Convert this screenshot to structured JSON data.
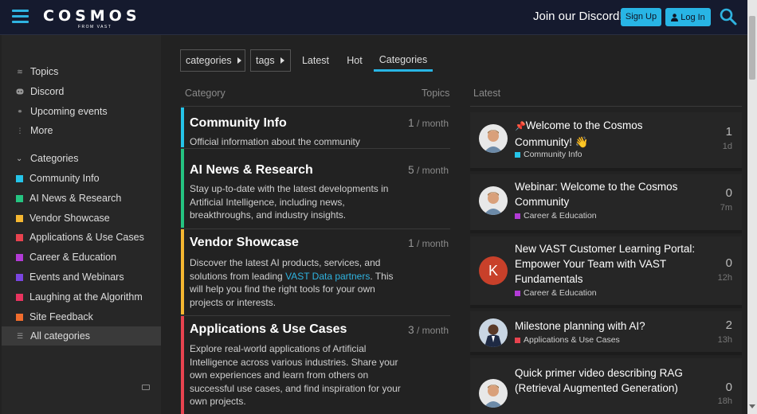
{
  "header": {
    "logo_main": "COSMOS",
    "logo_sub": "FROM VAST",
    "discord_text": "Join our Discord!",
    "signup_label": "Sign Up",
    "login_label": "Log In"
  },
  "sidebar": {
    "nav": [
      {
        "label": "Topics",
        "icon": "layers-icon"
      },
      {
        "label": "Discord",
        "icon": "discord-icon"
      },
      {
        "label": "Upcoming events",
        "icon": "link-icon"
      },
      {
        "label": "More",
        "icon": "vertical-ellipsis-icon"
      }
    ],
    "categories_header": "Categories",
    "categories": [
      {
        "label": "Community Info",
        "color": "#25c4e8"
      },
      {
        "label": "AI News & Research",
        "color": "#25c481"
      },
      {
        "label": "Vendor Showcase",
        "color": "#f5b731"
      },
      {
        "label": "Applications & Use Cases",
        "color": "#e8434f"
      },
      {
        "label": "Career & Education",
        "color": "#b23bd6"
      },
      {
        "label": "Events and Webinars",
        "color": "#7a45e0"
      },
      {
        "label": "Laughing at the Algorithm",
        "color": "#e8345f"
      },
      {
        "label": "Site Feedback",
        "color": "#f06c2d"
      }
    ],
    "all_categories": "All categories"
  },
  "nav": {
    "categories_dropdown": "categories",
    "tags_dropdown": "tags",
    "tabs": [
      "Latest",
      "Hot",
      "Categories"
    ],
    "active_tab": "Categories"
  },
  "table": {
    "col_category": "Category",
    "col_topics": "Topics",
    "col_latest": "Latest",
    "rows": [
      {
        "name": "Community Info",
        "count": "1",
        "unit": "/ month",
        "color": "#25c4e8",
        "desc": "Official information about the community"
      },
      {
        "name": "AI News & Research",
        "count": "5",
        "unit": "/ month",
        "color": "#25c481",
        "desc": "Stay up-to-date with the latest developments in Artificial Intelligence, including news, breakthroughs, and industry insights."
      },
      {
        "name": "Vendor Showcase",
        "count": "1",
        "unit": "/ month",
        "color": "#f5b731",
        "desc_before": "Discover the latest AI products, services, and solutions from leading ",
        "desc_link": "VAST Data partners",
        "desc_after": ". This will help you find the right tools for your own projects or interests."
      },
      {
        "name": "Applications & Use Cases",
        "count": "3",
        "unit": "/ month",
        "color": "#e8434f",
        "desc": "Explore real-world applications of Artificial Intelligence across various industries. Share your own experiences and learn from others on successful use cases, and find inspiration for your own projects."
      }
    ]
  },
  "latest": [
    {
      "title": "Welcome to the Cosmos Community! 👋",
      "category": "Community Info",
      "cat_color": "#25c4e8",
      "replies": "1",
      "age": "1d",
      "pinned": true,
      "avatar": "photo-man-1"
    },
    {
      "title": "Webinar: Welcome to the Cosmos Community",
      "category": "Career & Education",
      "cat_color": "#b23bd6",
      "replies": "0",
      "age": "7m",
      "avatar": "photo-man-1"
    },
    {
      "title": "New VAST Customer Learning Portal: Empower Your Team with VAST Fundamentals",
      "category": "Career & Education",
      "cat_color": "#b23bd6",
      "replies": "0",
      "age": "12h",
      "avatar": "K",
      "avatar_color": "#c8402a"
    },
    {
      "title": "Milestone planning with AI?",
      "category": "Applications & Use Cases",
      "cat_color": "#e8434f",
      "replies": "2",
      "age": "13h",
      "avatar": "photo-man-2"
    },
    {
      "title": "Quick primer video describing RAG (Retrieval Augmented Generation)",
      "category": "",
      "cat_color": "",
      "replies": "0",
      "age": "18h",
      "avatar": "photo-man-1"
    }
  ]
}
